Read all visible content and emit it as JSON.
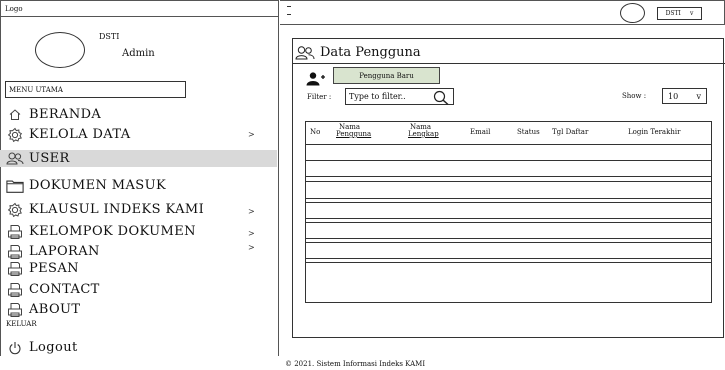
{
  "logo": "Logo",
  "profile": {
    "name": "DSTI",
    "role": "Admin"
  },
  "menu_title": "MENU UTAMA",
  "menu": [
    {
      "label": "BERANDA",
      "icon": "home-icon",
      "chevron": ""
    },
    {
      "label": "KELOLA DATA",
      "icon": "gear-icon",
      "chevron": ">"
    },
    {
      "label": "USER",
      "icon": "users-icon",
      "chevron": ""
    },
    {
      "label": "DOKUMEN MASUK",
      "icon": "folder-icon",
      "chevron": ""
    },
    {
      "label": "KLAUSUL INDEKS KAMI",
      "icon": "gear-icon",
      "chevron": ">"
    },
    {
      "label": "KELOMPOK DOKUMEN",
      "icon": "printer-icon",
      "chevron": ">"
    },
    {
      "label": "LAPORAN",
      "icon": "printer-icon",
      "chevron": ">"
    },
    {
      "label": "PESAN",
      "icon": "printer-icon",
      "chevron": ""
    },
    {
      "label": "CONTACT",
      "icon": "printer-icon",
      "chevron": ""
    },
    {
      "label": "ABOUT",
      "icon": "printer-icon",
      "chevron": ""
    }
  ],
  "keluar": "KELUAR",
  "logout": "Logout",
  "topbar": {
    "user": "DSTI",
    "caret": "v"
  },
  "panel": {
    "title": "Data Pengguna",
    "add_button": "Pengguna Baru",
    "filter_label": "Filter :",
    "filter_placeholder": "Type to filter..",
    "show_label": "Show :",
    "show_value": "10",
    "show_caret": "v"
  },
  "table": {
    "columns": [
      {
        "line1": "No",
        "line2": ""
      },
      {
        "line1": "Nama",
        "line2": "Pengguna"
      },
      {
        "line1": "Nama",
        "line2": "Lengkap"
      },
      {
        "line1": "Email",
        "line2": ""
      },
      {
        "line1": "Status",
        "line2": ""
      },
      {
        "line1": "Tgl Daftar",
        "line2": ""
      },
      {
        "line1": "Login Terakhir",
        "line2": ""
      }
    ]
  },
  "footer": "© 2021. Sistem Informasi Indeks KAMI"
}
